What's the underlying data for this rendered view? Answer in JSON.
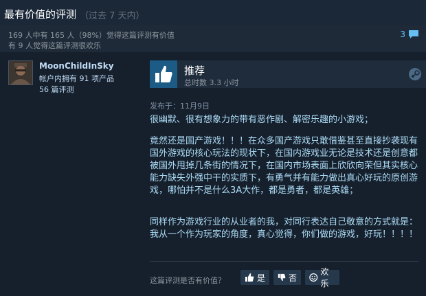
{
  "header": {
    "title": "最有价值的评测",
    "subtitle": "（过去 7 天内）"
  },
  "stats": {
    "helpful": "169 人中有 165 人（98%）觉得这篇评测有价值",
    "funny": "有 9 人觉得这篇评测很欢乐",
    "comments": "3"
  },
  "user": {
    "name": "MoonChildInSky",
    "games": "帐户内拥有 91 项产品",
    "reviews": "56 篇评测"
  },
  "review": {
    "verdict": "推荐",
    "hours": "总时数 3.3 小时",
    "posted": "发布于：11月9日",
    "p1": "很幽默、很有想象力的带有恶作剧、解密乐趣的小游戏；",
    "p2": "竟然还是国产游戏！！！在众多国产游戏只敢借鉴甚至直接抄袭现有国外游戏的核心玩法的现状下，在国内游戏业无论是技术还是创意都被国外甩掉几条街的情况下，在国内市场表面上欣欣向荣但其实核心能力缺失外强中干的实质下，有勇气并有能力做出真心好玩的原创游戏，哪怕并不是什么3A大作，都是勇者，都是英雄；",
    "p3": "同样作为游戏行业的从业者的我，对同行表达自己敬意的方式就是：我从一个作为玩家的角度，真心觉得，你们做的游戏，好玩！！！！"
  },
  "vote": {
    "question": "这篇评测是否有价值？",
    "yes": "是",
    "no": "否",
    "funny": "欢乐"
  },
  "colors": {
    "accent": "#66c0f4",
    "thumb_bg": "#1b5b86",
    "text_blue": "#acdbf5"
  },
  "icons": [
    "thumbs-up-icon",
    "comment-icon",
    "steam-icon",
    "thumbs-down-icon",
    "smiley-icon"
  ]
}
